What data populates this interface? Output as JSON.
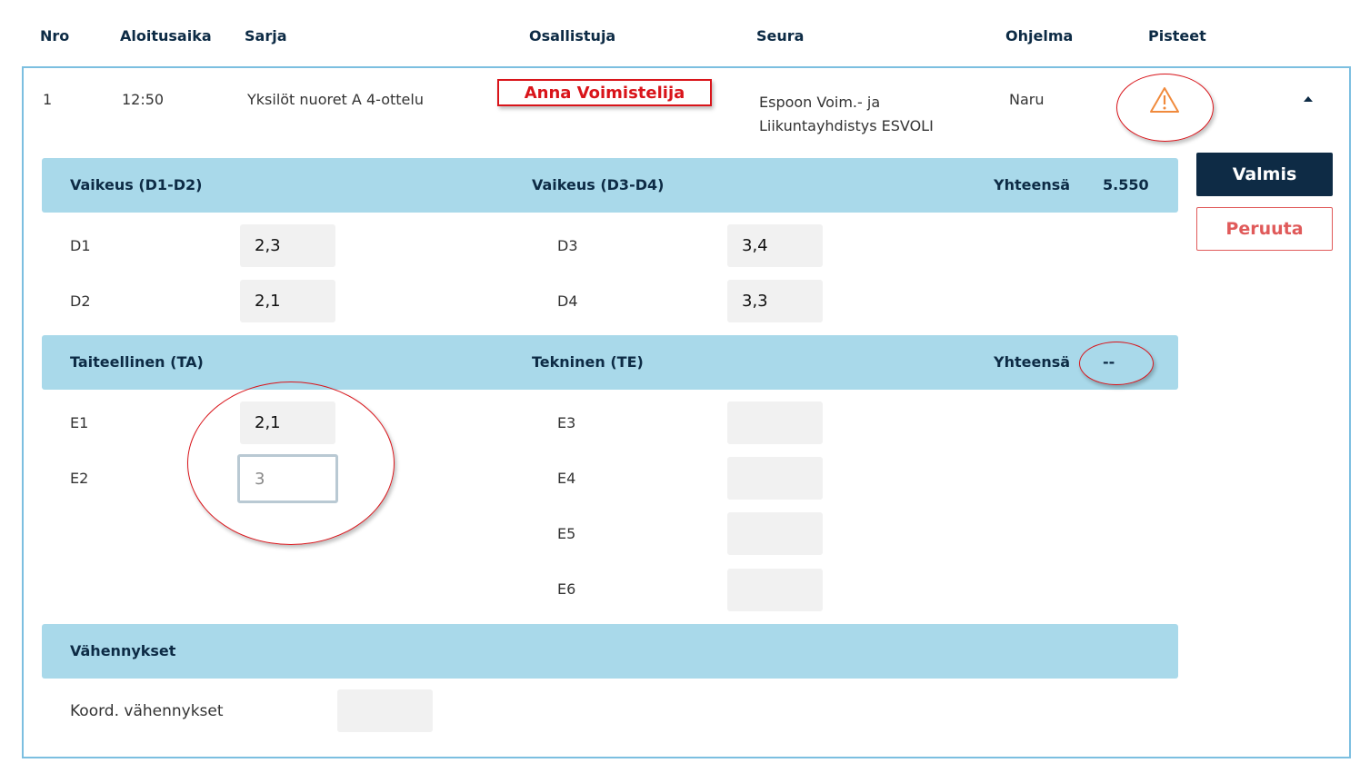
{
  "table": {
    "headers": {
      "nro": "Nro",
      "start": "Aloitusaika",
      "series": "Sarja",
      "participant": "Osallistuja",
      "club": "Seura",
      "program": "Ohjelma",
      "points": "Pisteet"
    },
    "row": {
      "nro": "1",
      "start": "12:50",
      "series": "Yksilöt nuoret A 4-ottelu",
      "participant": "Anna Voimistelija",
      "club_line1": "Espoon Voim.- ja",
      "club_line2": "Liikuntayhdistys ESVOLI",
      "program": "Naru",
      "points_icon": "warning-icon"
    }
  },
  "difficulty": {
    "left_title": "Vaikeus (D1-D2)",
    "right_title": "Vaikeus (D3-D4)",
    "total_label": "Yhteensä",
    "total_value": "5.550",
    "fields": {
      "d1_label": "D1",
      "d1_value": "2,3",
      "d2_label": "D2",
      "d2_value": "2,1",
      "d3_label": "D3",
      "d3_value": "3,4",
      "d4_label": "D4",
      "d4_value": "3,3"
    }
  },
  "execution": {
    "left_title": "Taiteellinen (TA)",
    "right_title": "Tekninen (TE)",
    "total_label": "Yhteensä",
    "total_value": "--",
    "fields": {
      "e1_label": "E1",
      "e1_value": "2,1",
      "e2_label": "E2",
      "e2_value": "3",
      "e3_label": "E3",
      "e3_value": "",
      "e4_label": "E4",
      "e4_value": "",
      "e5_label": "E5",
      "e5_value": "",
      "e6_label": "E6",
      "e6_value": ""
    }
  },
  "deductions": {
    "title": "Vähennykset",
    "coord_label": "Koord. vähennykset",
    "coord_value": ""
  },
  "actions": {
    "done_label": "Valmis",
    "cancel_label": "Peruuta"
  },
  "colors": {
    "navy": "#0e2b45",
    "band": "#a9d9ea",
    "annotation_red": "#d9141a",
    "warning_orange": "#f08a3c"
  }
}
